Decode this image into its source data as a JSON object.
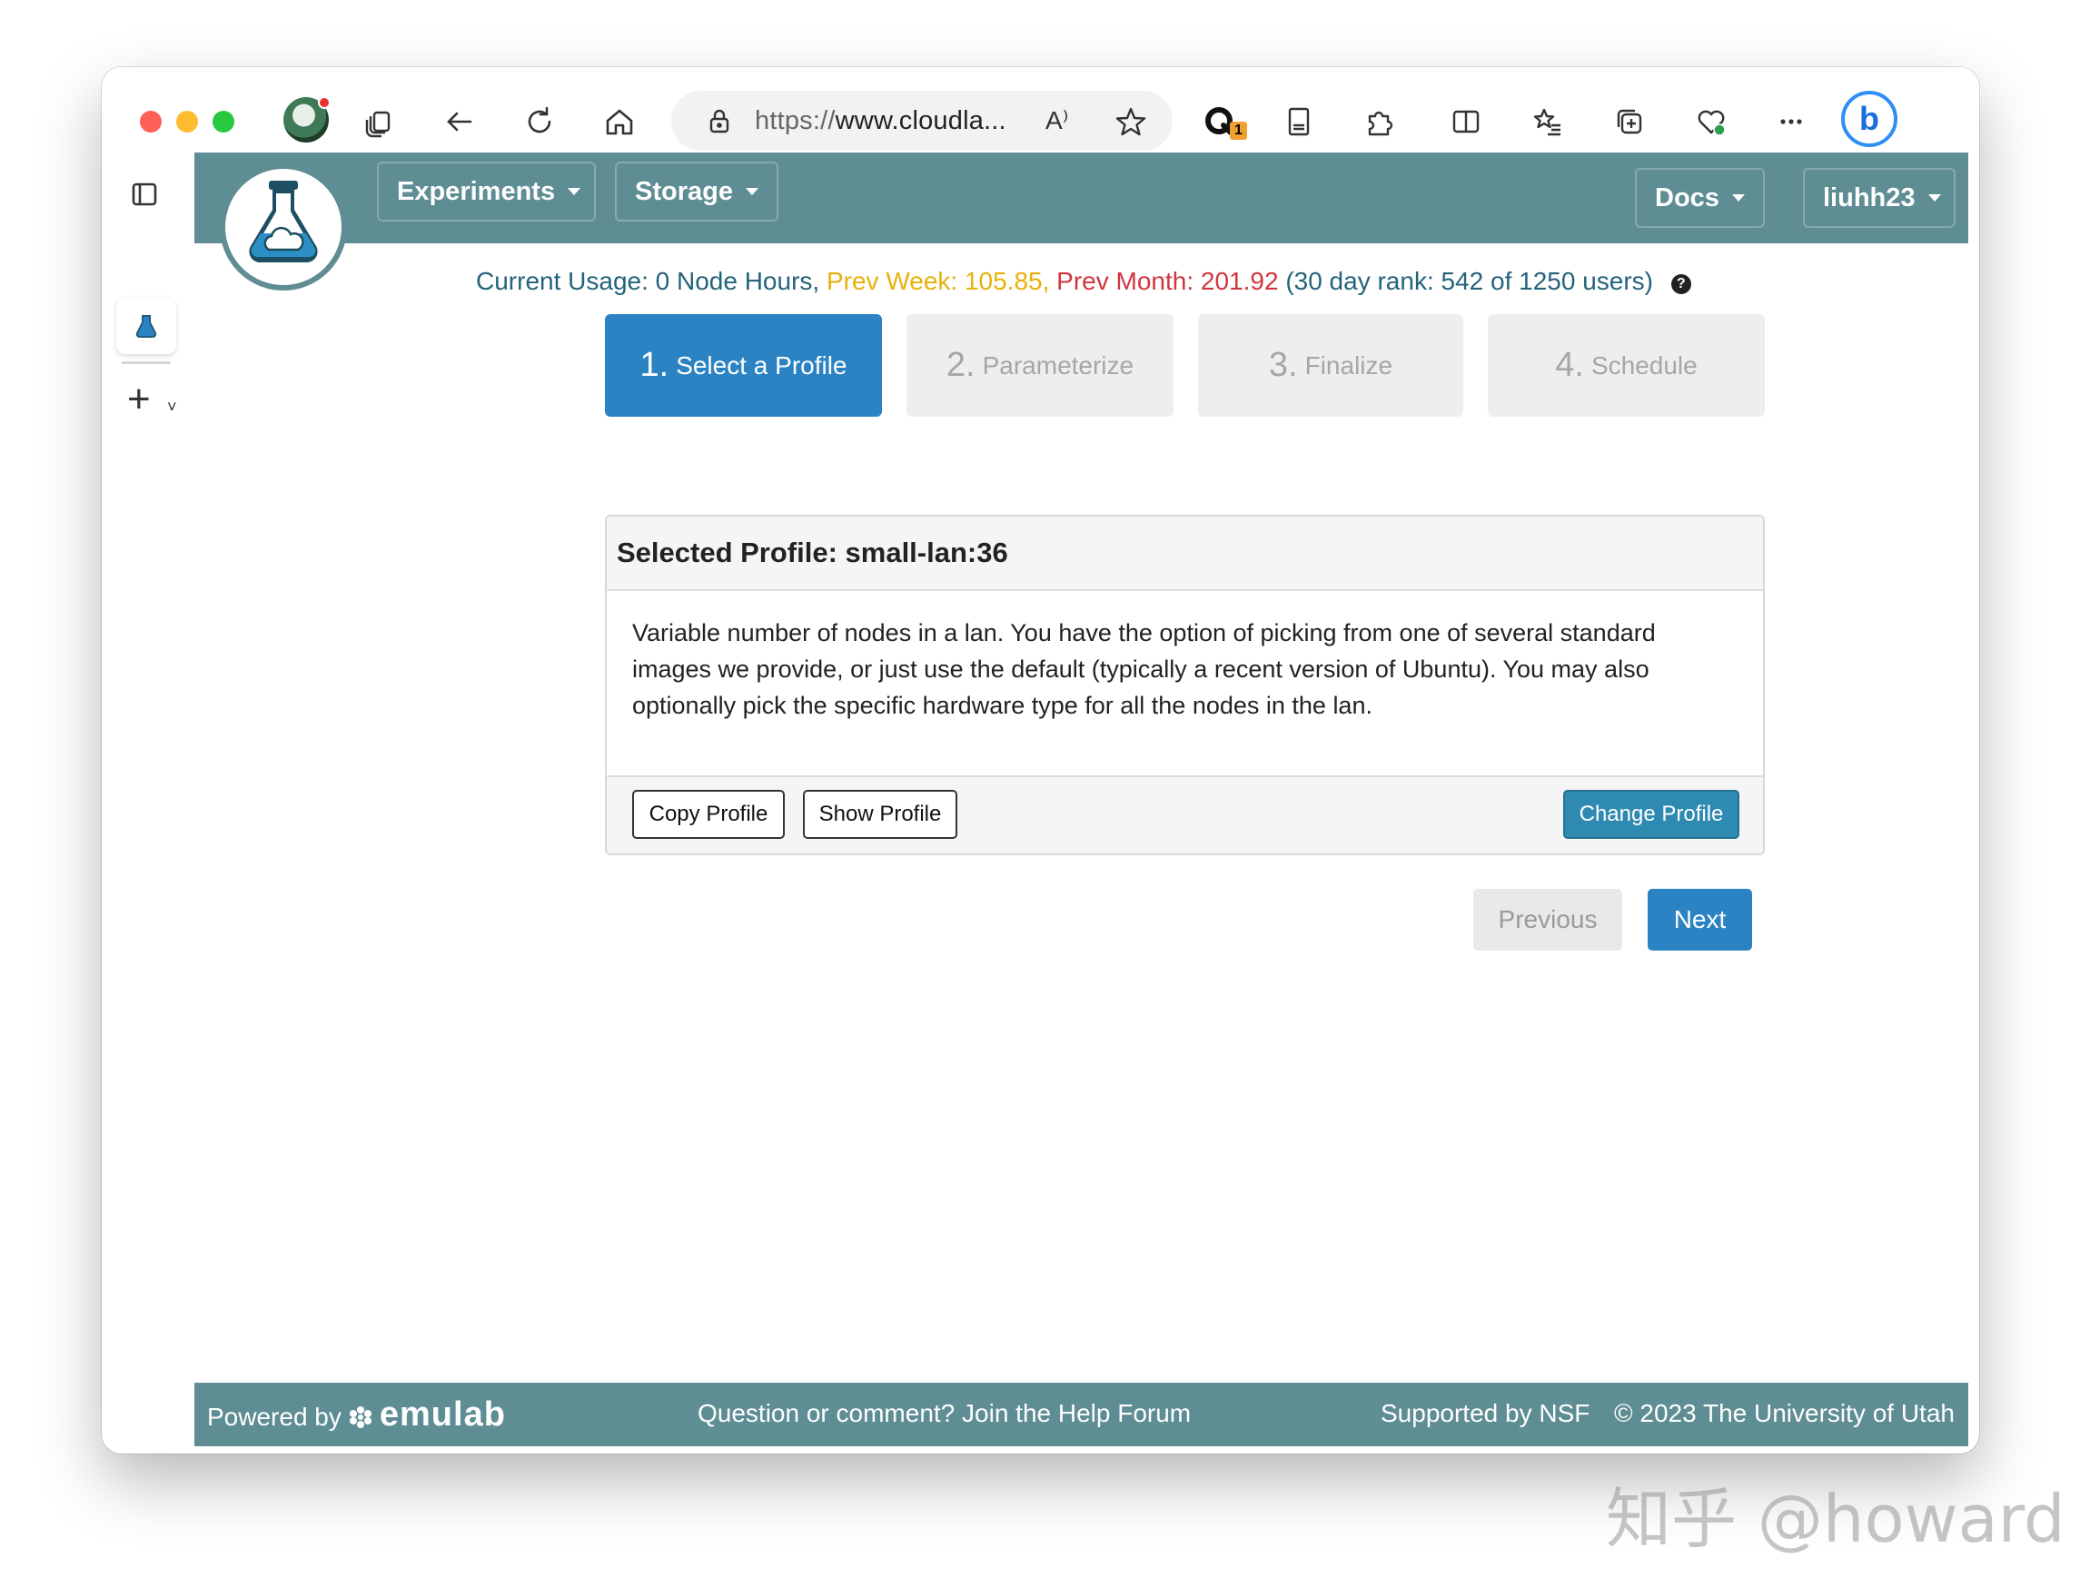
{
  "browser": {
    "url_scheme": "https://",
    "url_host": "www.cloudla...",
    "read_aloud": "A⁾",
    "extension_badge": "1",
    "bing_label": "b"
  },
  "navbar": {
    "experiments_label": "Experiments",
    "storage_label": "Storage",
    "docs_label": "Docs",
    "user_label": "liuhh23"
  },
  "usage": {
    "current": "Current Usage: 0 Node Hours,",
    "prev_week": "Prev Week: 105.85,",
    "prev_month": "Prev Month: 201.92",
    "rank": "(30 day rank: 542 of 1250 users)",
    "help_icon": "?"
  },
  "steps": [
    {
      "num": "1.",
      "label": "Select a Profile"
    },
    {
      "num": "2.",
      "label": "Parameterize"
    },
    {
      "num": "3.",
      "label": "Finalize"
    },
    {
      "num": "4.",
      "label": "Schedule"
    }
  ],
  "profile_panel": {
    "heading": "Selected Profile: small-lan:36",
    "description": "Variable number of nodes in a lan. You have the option of picking from one of several standard images we provide, or just use the default (typically a recent version of Ubuntu). You may also optionally pick the specific hardware type for all the nodes in the lan.",
    "copy_label": "Copy Profile",
    "show_label": "Show Profile",
    "change_label": "Change Profile"
  },
  "wizard_nav": {
    "previous_label": "Previous",
    "next_label": "Next"
  },
  "footer": {
    "powered_by": "Powered by",
    "emulab": "emulab",
    "help": "Question or comment? Join the Help Forum",
    "nsf": "Supported by NSF",
    "copyright": "© 2023 The University of Utah"
  },
  "watermark": "知乎 @howard",
  "colors": {
    "navbar": "#5e8d94",
    "step_active": "#2b83c4",
    "usage_text": "#24637c",
    "prev_week": "#e8b00a",
    "prev_month": "#d0363f",
    "change_button": "#2f8ab2"
  }
}
